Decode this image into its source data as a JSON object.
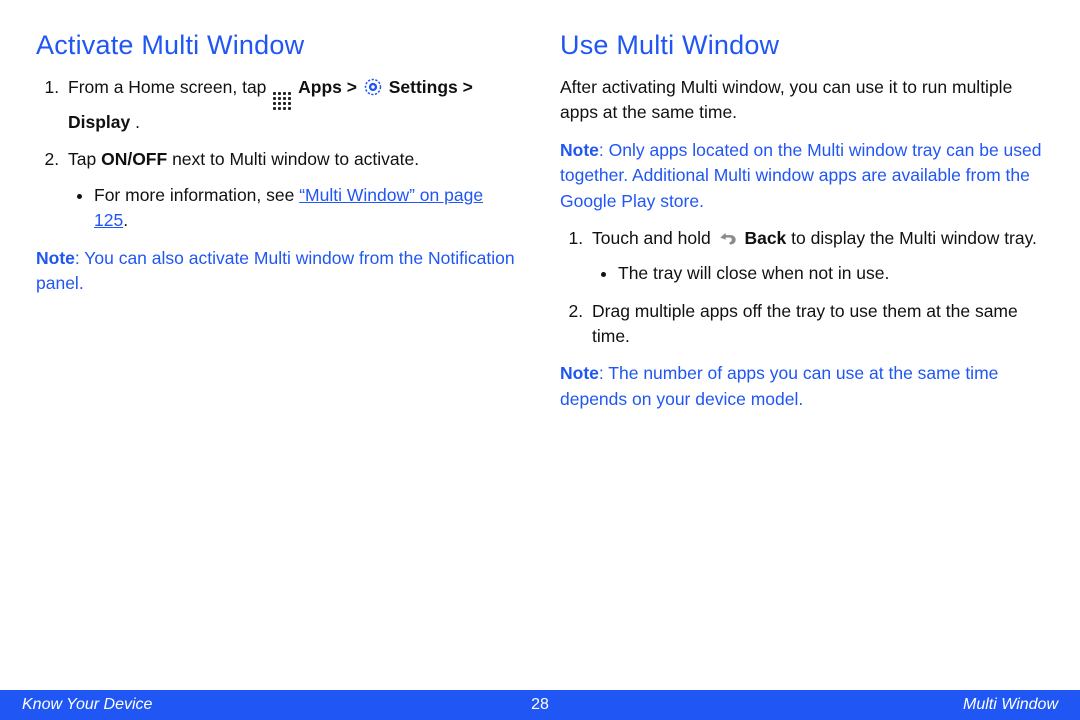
{
  "left": {
    "heading": "Activate Multi Window",
    "step1_pre": "From a Home screen, tap ",
    "step1_apps": "Apps > ",
    "step1_settings": "Settings > Display",
    "step1_end": ".",
    "step2_pre": "Tap ",
    "step2_onoff": "ON/OFF",
    "step2_post": " next to Multi window to activate.",
    "bullet1_pre": "For more information, see ",
    "bullet1_link": "“Multi Window” on page 125",
    "bullet1_post": ".",
    "note_label": "Note",
    "note_text": ": You can also activate Multi window from the Notification panel."
  },
  "right": {
    "heading": "Use Multi Window",
    "intro": "After activating Multi window, you can use it to run multiple apps at the same time.",
    "note1_label": "Note",
    "note1_text": ": Only apps located on the Multi window tray can be used together. Additional Multi window apps are available from the Google Play store.",
    "step1_pre": "Touch and hold ",
    "step1_back": "Back",
    "step1_post": " to display the Multi window tray.",
    "bullet1": "The tray will close when not in use.",
    "step2": "Drag multiple apps off the tray to use them at the same time.",
    "note2_label": "Note",
    "note2_text": ": The number of apps you can use at the same time depends on your device model."
  },
  "footer": {
    "left": "Know Your Device",
    "center": "28",
    "right": "Multi Window"
  }
}
